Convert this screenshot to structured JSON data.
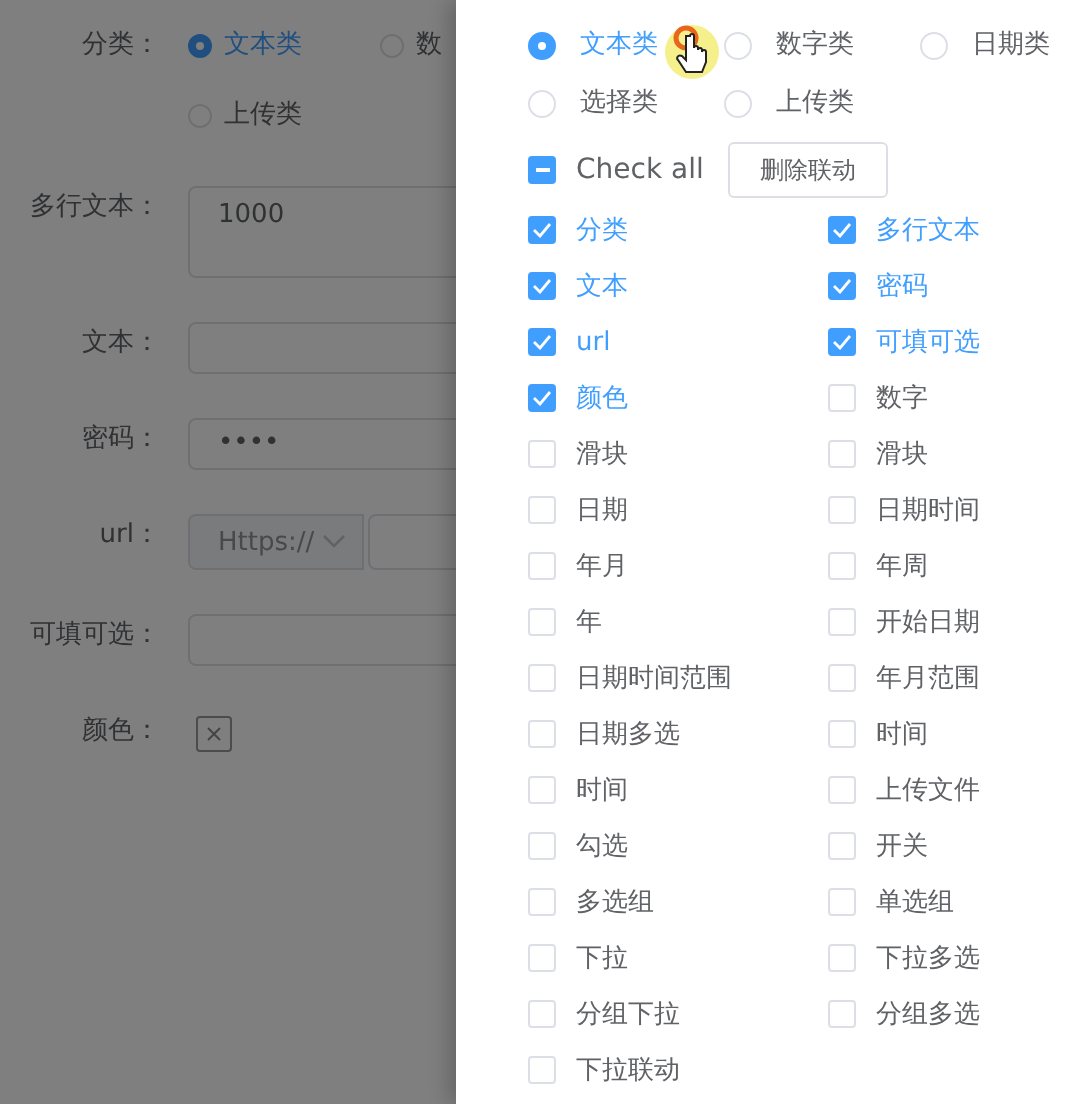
{
  "form": {
    "fields": [
      {
        "label": "分类：",
        "kind": "radio",
        "options": [
          {
            "label": "文本类",
            "selected": true
          },
          {
            "label": "数",
            "selected": false
          },
          {
            "label": "上传类",
            "selected": false
          }
        ]
      },
      {
        "label": "多行文本：",
        "kind": "textarea",
        "value": "1000"
      },
      {
        "label": "文本：",
        "kind": "input"
      },
      {
        "label": "密码：",
        "kind": "input",
        "value": "••••"
      },
      {
        "label": "url：",
        "kind": "url",
        "prefix": "Https://"
      },
      {
        "label": "可填可选：",
        "kind": "input"
      },
      {
        "label": "颜色：",
        "kind": "color"
      }
    ]
  },
  "drawer": {
    "types": [
      {
        "label": "文本类",
        "selected": true
      },
      {
        "label": "数字类",
        "selected": false
      },
      {
        "label": "日期类",
        "selected": false
      },
      {
        "label": "选择类",
        "selected": false
      },
      {
        "label": "上传类",
        "selected": false
      }
    ],
    "check_all": {
      "label": "Check all",
      "indeterminate": true
    },
    "button": "删除联动",
    "items": [
      {
        "label": "分类",
        "checked": true
      },
      {
        "label": "多行文本",
        "checked": true
      },
      {
        "label": "文本",
        "checked": true
      },
      {
        "label": "密码",
        "checked": true
      },
      {
        "label": "url",
        "checked": true
      },
      {
        "label": "可填可选",
        "checked": true
      },
      {
        "label": "颜色",
        "checked": true
      },
      {
        "label": "数字",
        "checked": false
      },
      {
        "label": "滑块",
        "checked": false
      },
      {
        "label": "滑块",
        "checked": false
      },
      {
        "label": "日期",
        "checked": false
      },
      {
        "label": "日期时间",
        "checked": false
      },
      {
        "label": "年月",
        "checked": false
      },
      {
        "label": "年周",
        "checked": false
      },
      {
        "label": "年",
        "checked": false
      },
      {
        "label": "开始日期",
        "checked": false
      },
      {
        "label": "日期时间范围",
        "checked": false
      },
      {
        "label": "年月范围",
        "checked": false
      },
      {
        "label": "日期多选",
        "checked": false
      },
      {
        "label": "时间",
        "checked": false
      },
      {
        "label": "时间",
        "checked": false
      },
      {
        "label": "上传文件",
        "checked": false
      },
      {
        "label": "勾选",
        "checked": false
      },
      {
        "label": "开关",
        "checked": false
      },
      {
        "label": "多选组",
        "checked": false
      },
      {
        "label": "单选组",
        "checked": false
      },
      {
        "label": "下拉",
        "checked": false
      },
      {
        "label": "下拉多选",
        "checked": false
      },
      {
        "label": "分组下拉",
        "checked": false
      },
      {
        "label": "分组多选",
        "checked": false
      },
      {
        "label": "下拉联动",
        "checked": false
      }
    ]
  }
}
